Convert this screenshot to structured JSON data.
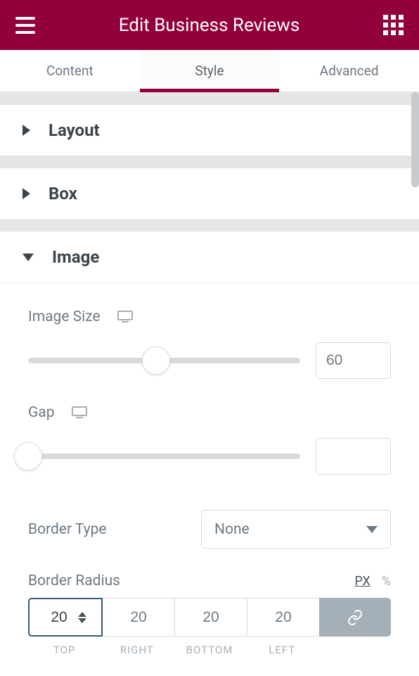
{
  "header": {
    "title": "Edit Business Reviews"
  },
  "tabs": {
    "content": "Content",
    "style": "Style",
    "advanced": "Advanced"
  },
  "sections": {
    "layout": {
      "title": "Layout"
    },
    "box": {
      "title": "Box"
    },
    "image": {
      "title": "Image",
      "image_size": {
        "label": "Image Size",
        "value": "60",
        "percent": 47
      },
      "gap": {
        "label": "Gap",
        "value": "",
        "percent": 0
      },
      "border_type": {
        "label": "Border Type",
        "value": "None"
      },
      "border_radius": {
        "label": "Border Radius",
        "units": {
          "px": "PX",
          "pct": "%"
        },
        "top": "20",
        "right": "20",
        "bottom": "20",
        "left": "20",
        "labels": {
          "top": "TOP",
          "right": "RIGHT",
          "bottom": "BOTTOM",
          "left": "LEFT"
        }
      }
    }
  }
}
